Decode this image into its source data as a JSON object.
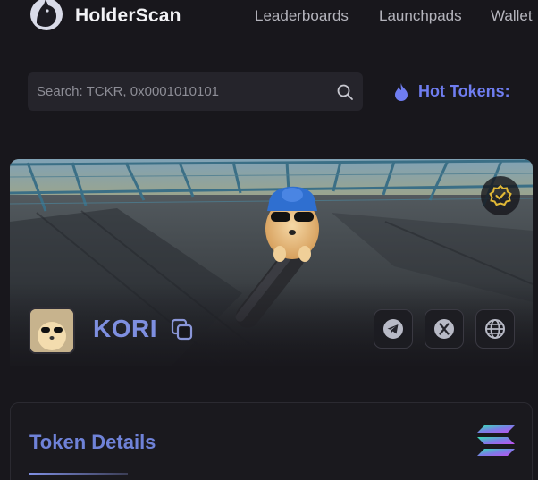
{
  "header": {
    "brand": "HolderScan",
    "nav": [
      "Leaderboards",
      "Launchpads",
      "Wallet"
    ]
  },
  "search": {
    "placeholder": "Search: TCKR, 0x0001010101"
  },
  "hot_tokens": {
    "label": "Hot Tokens:"
  },
  "token": {
    "name": "KORI",
    "verified": true,
    "socials": [
      "telegram-icon",
      "x-icon",
      "globe-icon"
    ]
  },
  "details": {
    "title": "Token Details",
    "chain_icon": "solana-icon"
  },
  "colors": {
    "background": "#18171c",
    "accent": "#6f7df0",
    "token_name": "#7e8fe0",
    "verified": "#e0b836"
  }
}
